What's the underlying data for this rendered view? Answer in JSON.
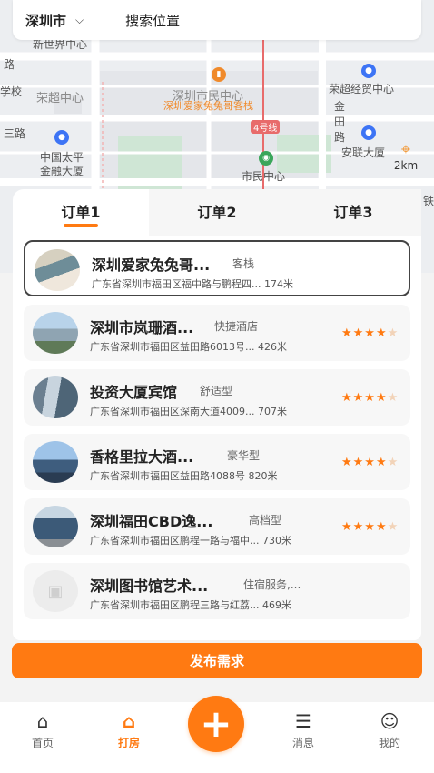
{
  "search": {
    "city": "深圳市",
    "placeholder": "搜索位置"
  },
  "map": {
    "labels": [
      "路",
      "学校",
      "荣超中心",
      "三路",
      "中国太平",
      "金融大厦",
      "深圳市民中心",
      "深圳爱家兔兔哥客栈",
      "荣超经贸中心",
      "金",
      "田",
      "路",
      "安联大厦",
      "市民中心",
      "铁",
      "新世界中心"
    ],
    "metro": "4号线",
    "distance": "2km",
    "accent": "#f08a2b"
  },
  "tabs": [
    "订单1",
    "订单2",
    "订单3"
  ],
  "hotels": [
    {
      "name": "深圳爱家兔兔哥...",
      "tag": "客栈",
      "address": "广东省深圳市福田区福中路与鹏程四...",
      "distance": "174米",
      "rating": null
    },
    {
      "name": "深圳市岚珊酒...",
      "tag": "快捷酒店",
      "address": "广东省深圳市福田区益田路6013号...",
      "distance": "426米",
      "rating": 4.5
    },
    {
      "name": "投资大厦宾馆",
      "tag": "舒适型",
      "address": "广东省深圳市福田区深南大道4009...",
      "distance": "707米",
      "rating": 4
    },
    {
      "name": "香格里拉大酒...",
      "tag": "豪华型",
      "address": "广东省深圳市福田区益田路4088号",
      "distance": "820米",
      "rating": 4.5
    },
    {
      "name": "深圳福田CBD逸...",
      "tag": "高档型",
      "address": "广东省深圳市福田区鹏程一路与福中...",
      "distance": "730米",
      "rating": 4.5
    },
    {
      "name": "深圳图书馆艺术...",
      "tag": "住宿服务,...",
      "address": "广东省深圳市福田区鹏程三路与红荔...",
      "distance": "469米",
      "rating": null
    }
  ],
  "publish_label": "发布需求",
  "nav": [
    {
      "label": "首页",
      "icon": "home-icon"
    },
    {
      "label": "打房",
      "icon": "hotel-icon"
    },
    {
      "label": "消息",
      "icon": "message-icon"
    },
    {
      "label": "我的",
      "icon": "profile-icon"
    }
  ],
  "colors": {
    "accent": "#ff7a12",
    "metro": "#e86b6b",
    "pin": "#3d74f5"
  }
}
